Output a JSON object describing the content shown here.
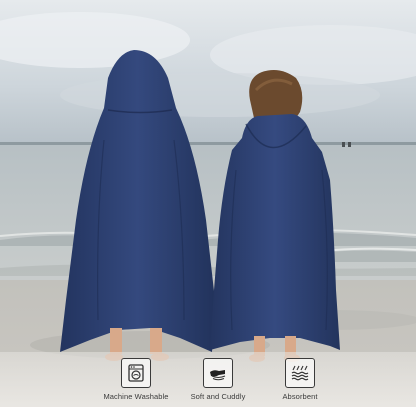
{
  "features": [
    {
      "label": "Machine Washable",
      "icon": "washing-machine-icon"
    },
    {
      "label": "Soft and Cuddly",
      "icon": "hand-towel-icon"
    },
    {
      "label": "Absorbent",
      "icon": "water-absorb-icon"
    }
  ],
  "colors": {
    "towel": "#2c3f70",
    "sky": "#d7dde2",
    "sea": "#b9c2c6",
    "sand": "#c7c4bd"
  }
}
